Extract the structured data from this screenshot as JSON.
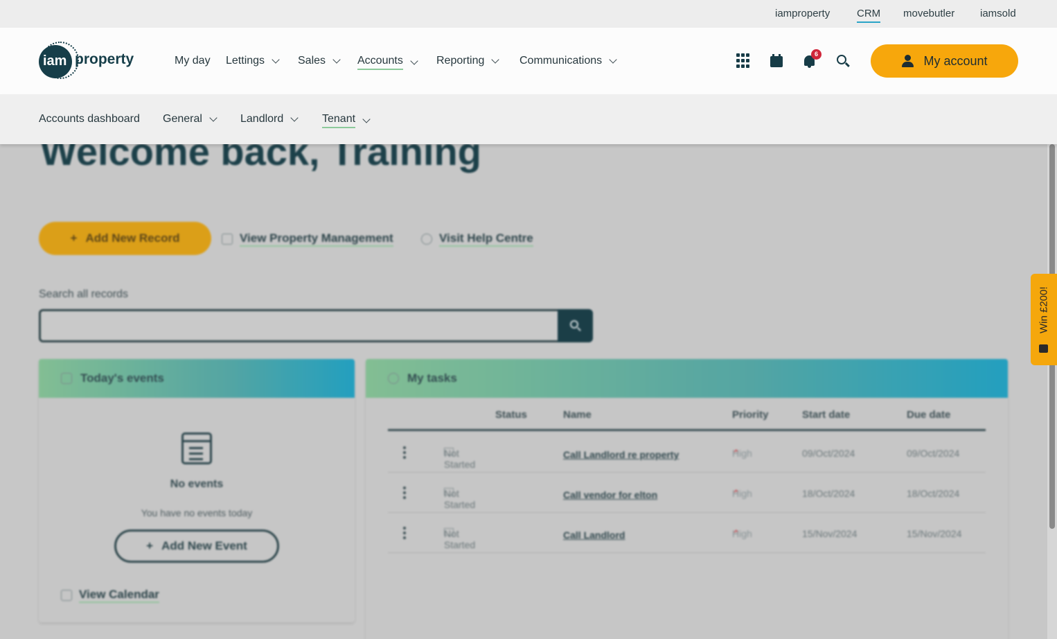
{
  "topbar": {
    "links": [
      "iamproperty",
      "CRM",
      "movebutler",
      "iamsold"
    ],
    "active": "CRM"
  },
  "header": {
    "logo": {
      "mark": "iam",
      "word": "property"
    },
    "nav": [
      {
        "label": "My day",
        "dropdown": false
      },
      {
        "label": "Lettings",
        "dropdown": true
      },
      {
        "label": "Sales",
        "dropdown": true
      },
      {
        "label": "Accounts",
        "dropdown": true,
        "active": true
      },
      {
        "label": "Reporting",
        "dropdown": true
      },
      {
        "label": "Communications",
        "dropdown": true
      }
    ],
    "icons": [
      "apps-grid-icon",
      "calendar-icon",
      "bell-icon",
      "search-icon"
    ],
    "notification_count": "6",
    "account_label": "My account",
    "accent": "#f7a70c"
  },
  "subnav": [
    {
      "label": "Accounts dashboard",
      "dropdown": false
    },
    {
      "label": "General",
      "dropdown": true
    },
    {
      "label": "Landlord",
      "dropdown": true
    },
    {
      "label": "Tenant",
      "dropdown": true,
      "active": true
    }
  ],
  "main": {
    "welcome": "Welcome back, Training",
    "add_record": "Add New Record",
    "view_pm": "View Property Management",
    "help": "Visit Help Centre",
    "search_label": "Search all records",
    "search_placeholder": ""
  },
  "events": {
    "title": "Today's events",
    "empty_title": "No events",
    "empty_sub": "You have no events today",
    "add_event": "Add New Event",
    "view_calendar": "View Calendar"
  },
  "tasks": {
    "title": "My tasks",
    "columns": [
      "Status",
      "Name",
      "Priority",
      "Start date",
      "Due date"
    ],
    "rows": [
      {
        "status": "Not Started",
        "name": "Call Landlord re property",
        "priority": "High",
        "start": "09/Oct/2024",
        "due": "09/Oct/2024"
      },
      {
        "status": "Not Started",
        "name": "Call vendor for elton",
        "priority": "High",
        "start": "18/Oct/2024",
        "due": "18/Oct/2024"
      },
      {
        "status": "Not Started",
        "name": "Call Landlord",
        "priority": "High",
        "start": "15/Nov/2024",
        "due": "15/Nov/2024"
      }
    ]
  },
  "promo": {
    "label": "Win £200!"
  }
}
